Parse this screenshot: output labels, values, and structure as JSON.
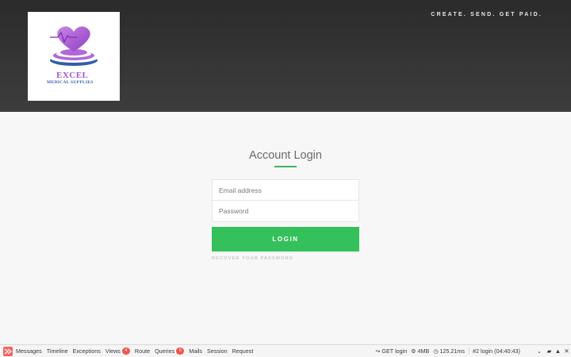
{
  "header": {
    "logo_name": "EXCEL",
    "logo_subtitle": "MEDICAL SUPPLIES",
    "tagline": "CREATE. SEND. GET PAID."
  },
  "login": {
    "title": "Account Login",
    "email_placeholder": "Email address",
    "password_placeholder": "Password",
    "submit_label": "LOGIN",
    "recover_label": "RECOVER YOUR PASSWORD"
  },
  "debugbar": {
    "tabs": [
      {
        "label": "Messages"
      },
      {
        "label": "Timeline"
      },
      {
        "label": "Exceptions"
      },
      {
        "label": "Views",
        "badge": "4"
      },
      {
        "label": "Route"
      },
      {
        "label": "Queries",
        "badge": "6"
      },
      {
        "label": "Mails"
      },
      {
        "label": "Session"
      },
      {
        "label": "Request"
      }
    ],
    "request": "GET login",
    "memory": "4MB",
    "duration": "125.21ms",
    "dataset": "#2 login (04:40:43)"
  },
  "colors": {
    "accent": "#34c05a",
    "header_bg": "#333333",
    "badge": "#f0554d",
    "logo_purple": "#9b59d0",
    "logo_blue": "#2f5fa8"
  }
}
